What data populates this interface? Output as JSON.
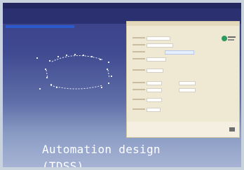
{
  "caption": {
    "line1": "Automation design",
    "line2": "(TDSS)"
  }
}
